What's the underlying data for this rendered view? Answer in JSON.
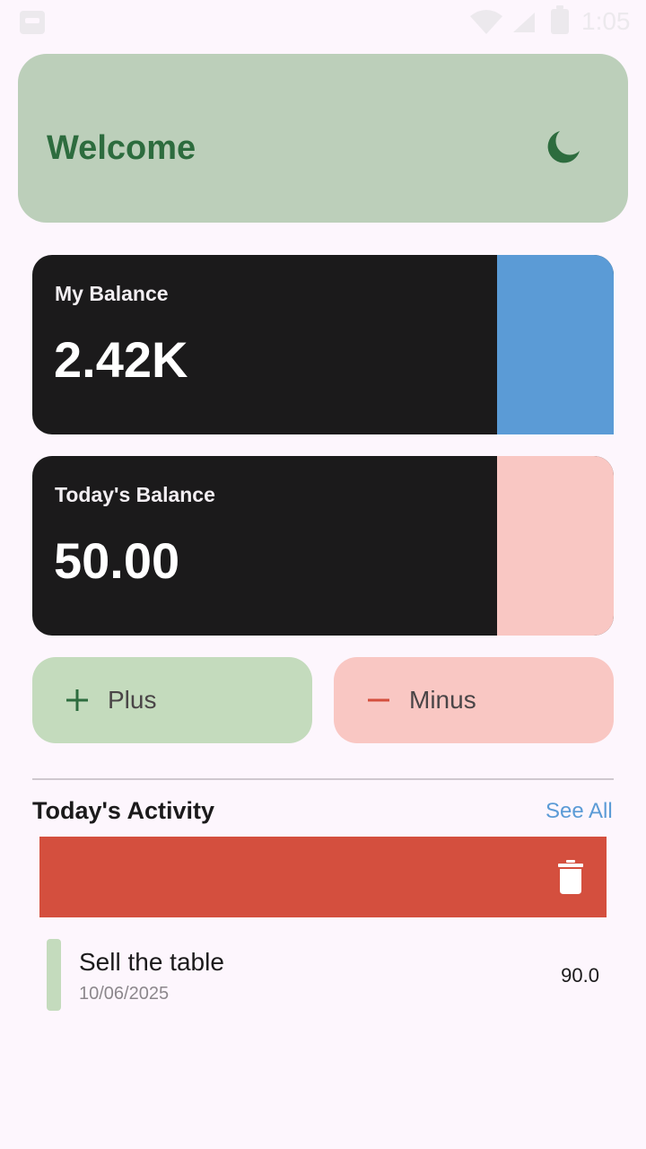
{
  "status_bar": {
    "time": "1:05"
  },
  "header": {
    "title": "Welcome",
    "theme_icon": "moon-icon"
  },
  "balances": [
    {
      "label": "My Balance",
      "value": "2.42K",
      "accent": "#5b9bd6"
    },
    {
      "label": "Today's Balance",
      "value": "50.00",
      "accent": "#f9c7c3"
    }
  ],
  "actions": {
    "plus_label": "Plus",
    "plus_icon": "plus-icon",
    "plus_color": "#2d6c3e",
    "minus_label": "Minus",
    "minus_icon": "minus-icon",
    "minus_color": "#d44f3e"
  },
  "activity": {
    "title": "Today's Activity",
    "see_all_label": "See All",
    "delete_icon": "trash-icon",
    "items": [
      {
        "title": "Sell the table",
        "date": "10/06/2025",
        "amount": "90.0"
      }
    ]
  },
  "colors": {
    "background": "#fdf6fd",
    "welcome_bg": "#bccfba",
    "welcome_text": "#2d6c3e",
    "card_bg": "#1b1a1b",
    "delete_bg": "#d44f3e",
    "link": "#5b9bd6"
  }
}
